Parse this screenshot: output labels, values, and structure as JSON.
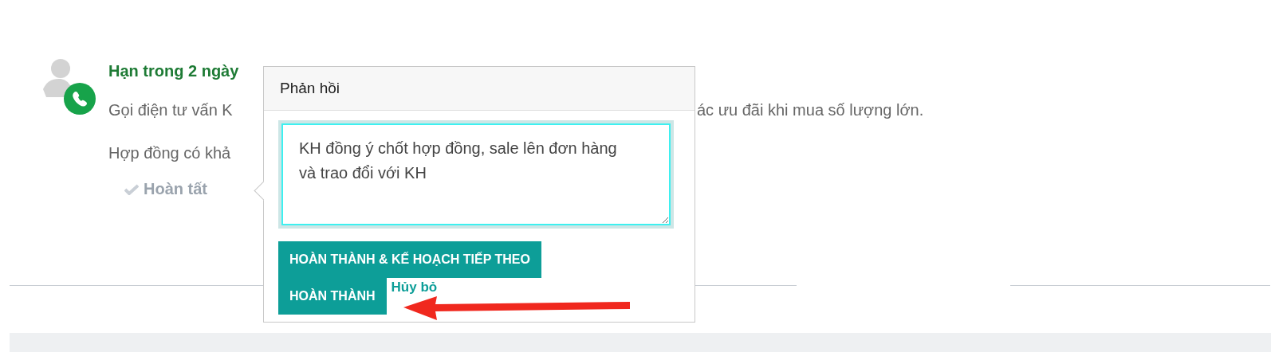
{
  "activity": {
    "title": "Hạn trong 2 ngày",
    "summary_visible_left": "Gọi điện tư vấn K",
    "summary_visible_right": "ác ưu đãi khi mua số lượng lớn.",
    "note": "Hợp đồng có khả",
    "done_link": "Hoàn tất"
  },
  "popover": {
    "title": "Phản hồi",
    "feedback": "KH đồng ý chốt hợp đồng, sale lên đơn hàng và trao đổi với KH",
    "buttons": [
      {
        "label": "HOÀN THÀNH & KẾ HOẠCH TIẾP THEO",
        "kind": "primary"
      },
      {
        "label": "HOÀN THÀNH",
        "kind": "primary"
      },
      {
        "label": "Hủy bỏ",
        "kind": "link"
      }
    ]
  }
}
